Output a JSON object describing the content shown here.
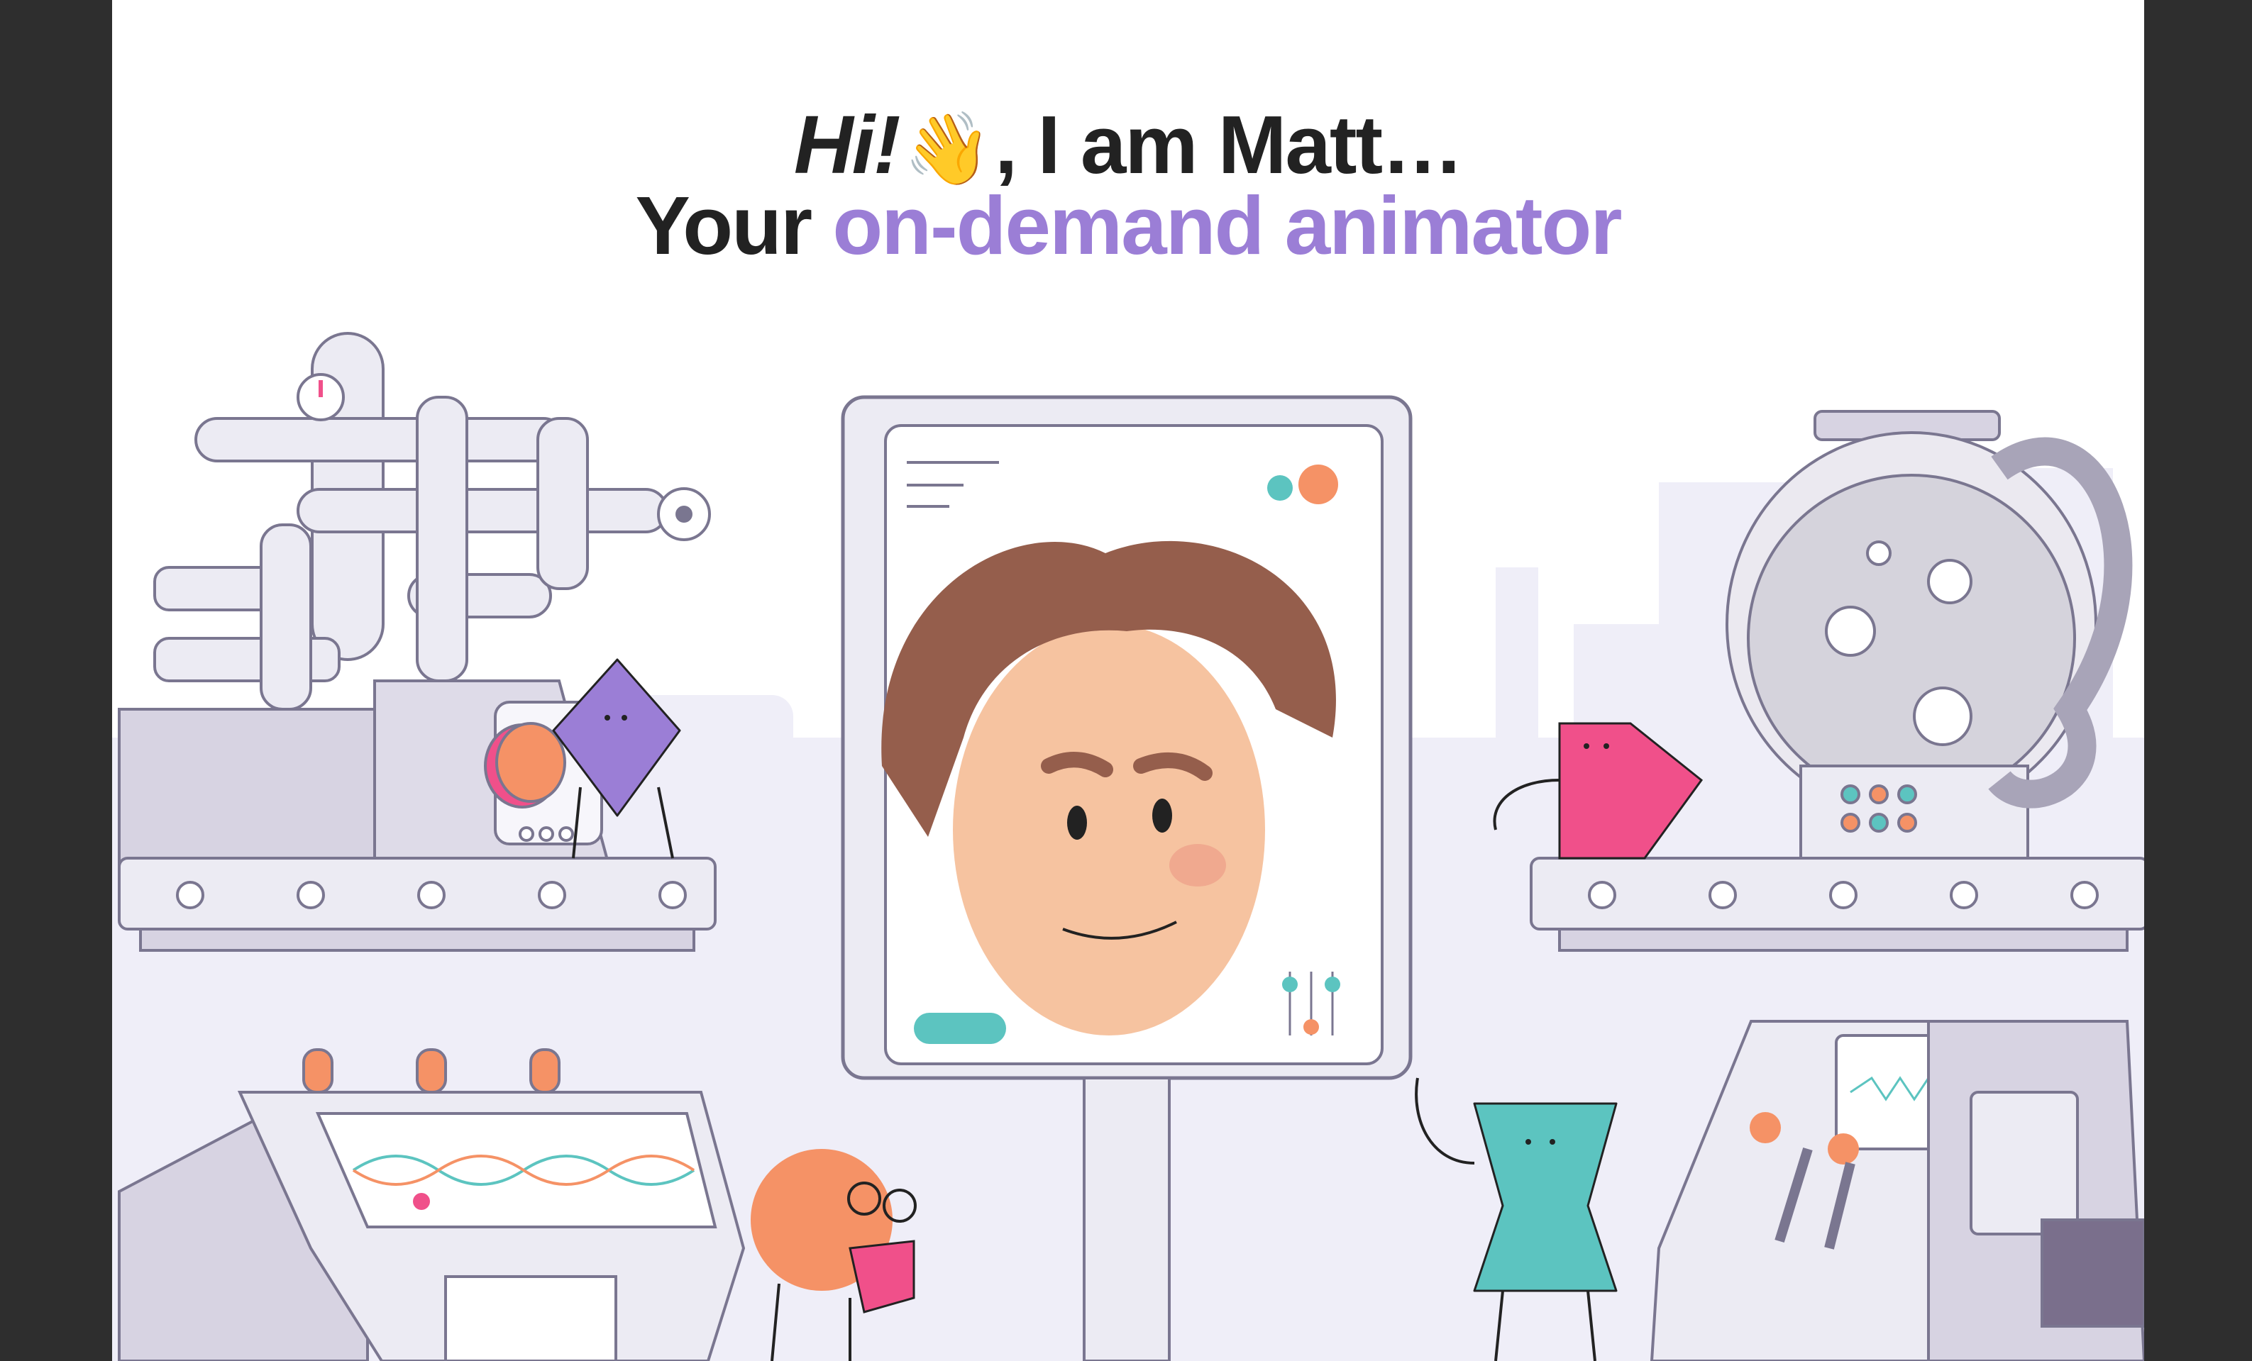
{
  "hero": {
    "greeting": "Hi!",
    "wave_emoji": "👋",
    "intro": ", I am Matt…",
    "prefix": "Your ",
    "highlight": "on-demand animator"
  },
  "colors": {
    "background_frame": "#2e2e2e",
    "page": "#ffffff",
    "accent_purple": "#9b7ed6",
    "pink": "#f0508a",
    "teal": "#5cc4c0",
    "orange": "#f59266",
    "machine_gray": "#e4e2ee",
    "machine_stroke": "#7a7690",
    "hair_brown": "#955e4c",
    "skin": "#f6c3a0"
  },
  "icons": [
    "wave-icon",
    "pressure-gauge-icon",
    "valve-wheel-icon",
    "pie-chart-icon",
    "slider-icon"
  ]
}
